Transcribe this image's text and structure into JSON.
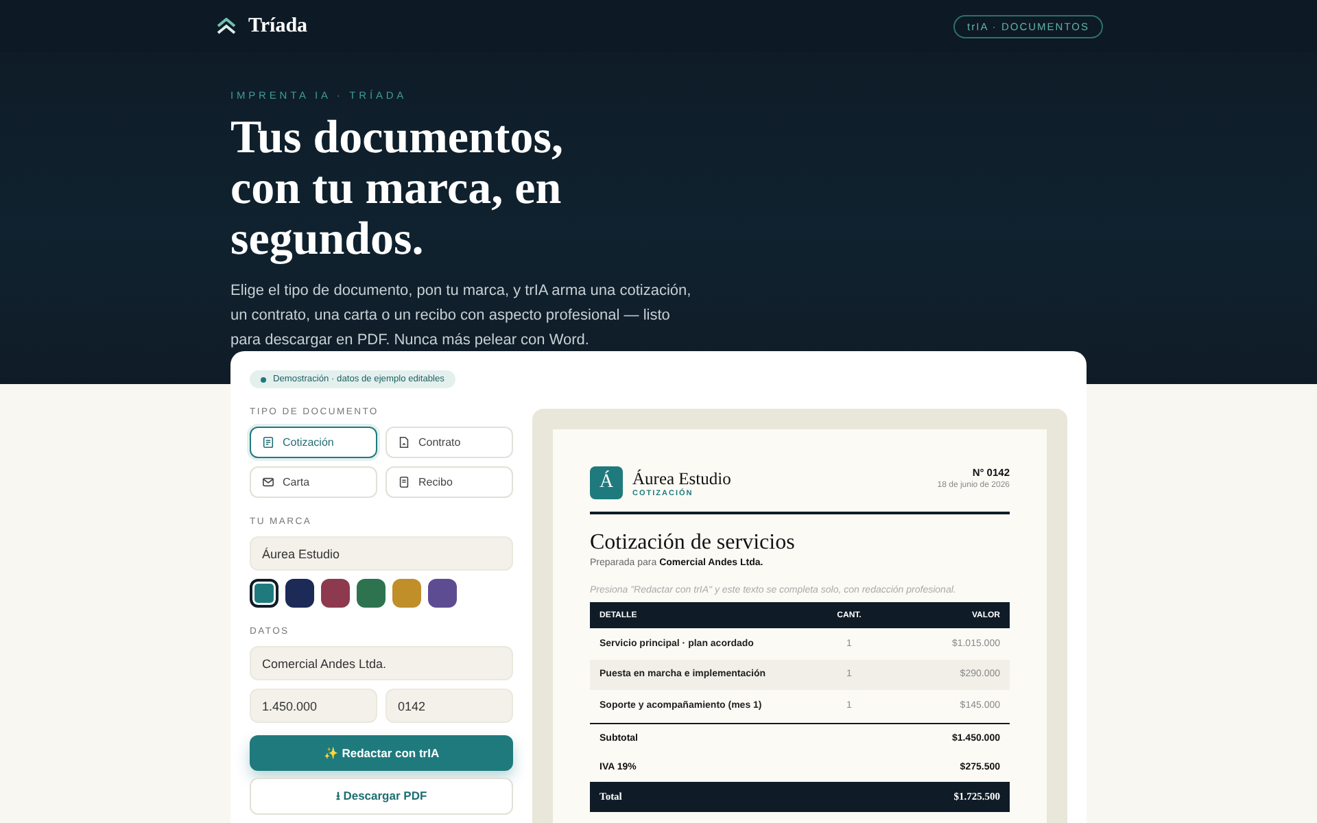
{
  "header": {
    "brand": "Tríada",
    "badge": "trIA · DOCUMENTOS"
  },
  "hero": {
    "eyebrow": "IMPRENTA IA · TRÍADA",
    "title": "Tus documentos, con tu marca, en segundos.",
    "lead": "Elige el tipo de documento, pon tu marca, y trIA arma una cotización, un contrato, una carta o un recibo con aspecto profesional — listo para descargar en PDF. Nunca más pelear con Word."
  },
  "form": {
    "demo_badge": "Demostración · datos de ejemplo editables",
    "doc_type_label": "TIPO DE DOCUMENTO",
    "doc_types": [
      {
        "label": "Cotización",
        "kind": "quote",
        "selected": true
      },
      {
        "label": "Contrato",
        "kind": "contract",
        "selected": false
      },
      {
        "label": "Carta",
        "kind": "letter",
        "selected": false
      },
      {
        "label": "Recibo",
        "kind": "receipt",
        "selected": false
      }
    ],
    "brand_label": "TU MARCA",
    "brand_name": "Áurea Estudio",
    "colors": [
      {
        "color": "#1f7a7e",
        "selected": true
      },
      {
        "color": "#1c2a58",
        "selected": false
      },
      {
        "color": "#8e3a4e",
        "selected": false
      },
      {
        "color": "#2d7350",
        "selected": false
      },
      {
        "color": "#c08f2a",
        "selected": false
      },
      {
        "color": "#5e4c93",
        "selected": false
      }
    ],
    "data_label": "DATOS",
    "client": "Comercial Andes Ltda.",
    "amount": "1.450.000",
    "number": "0142",
    "primary_button": "✨ Redactar con trIA",
    "secondary_button": "⭳ Descargar PDF"
  },
  "document": {
    "logo_letter": "Á",
    "brand": "Áurea Estudio",
    "doc_kind": "COTIZACIÓN",
    "number": "N° 0142",
    "date": "18 de junio de 2026",
    "title": "Cotización de servicios",
    "prepared_for": "Preparada para **Comercial Andes Ltda.**",
    "hint": "Presiona \"Redactar con trIA\" y este texto se completa solo, con redacción profesional.",
    "table": {
      "columns": [
        "DETALLE",
        "CANT.",
        "VALOR"
      ],
      "rows": [
        [
          "Servicio principal · plan acordado",
          "1",
          "$1.015.000"
        ],
        [
          "Puesta en marcha e implementación",
          "1",
          "$290.000"
        ],
        [
          "Soporte y acompañamiento (mes 1)",
          "1",
          "$145.000"
        ]
      ]
    },
    "totals": [
      {
        "label": "Subtotal",
        "value": "$1.450.000",
        "kind": "plain"
      },
      {
        "label": "IVA 19%",
        "value": "$275.500",
        "kind": "plain"
      },
      {
        "label": "Total",
        "value": "$1.725.500",
        "kind": "grand"
      }
    ]
  }
}
